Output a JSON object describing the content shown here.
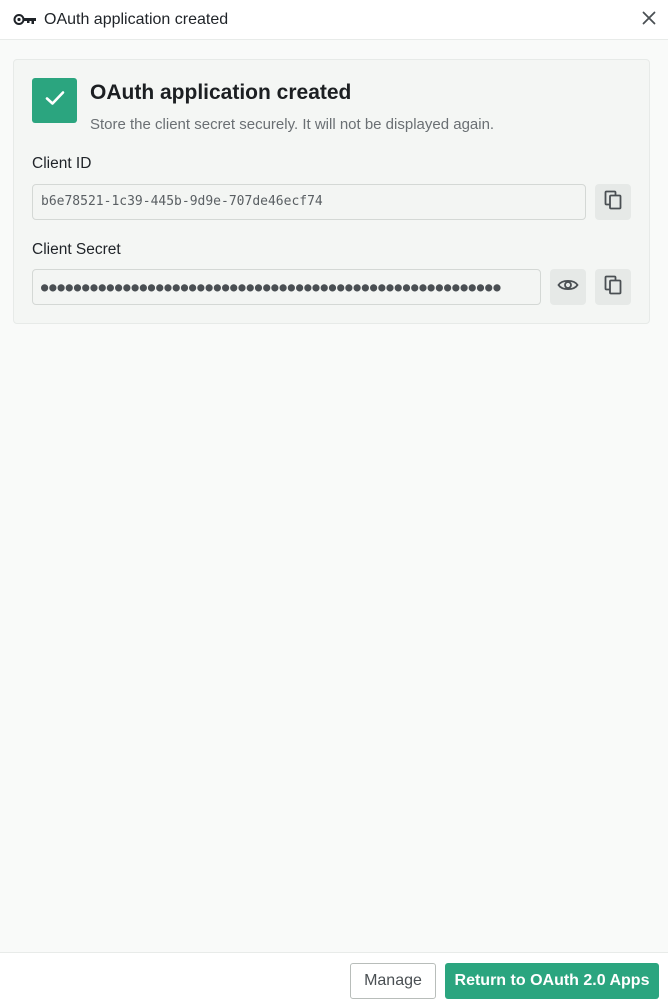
{
  "window": {
    "title": "OAuth application created",
    "title_icon": "key-icon",
    "close_icon": "close-icon"
  },
  "card": {
    "status_icon": "check-icon",
    "title": "OAuth application created",
    "subtitle": "Store the client secret securely. It will not be displayed again.",
    "client_id": {
      "label": "Client ID",
      "value": "b6e78521-1c39-445b-9d9e-707de46ecf74",
      "copy_icon": "copy-icon"
    },
    "client_secret": {
      "label": "Client Secret",
      "value": "●●●●●●●●●●●●●●●●●●●●●●●●●●●●●●●●●●●●●●●●●●●●●●●●●●●●●●●●",
      "reveal_icon": "eye-icon",
      "copy_icon": "copy-icon"
    }
  },
  "footer": {
    "manage_label": "Manage",
    "return_label": "Return to OAuth 2.0 Apps"
  },
  "colors": {
    "accent": "#2ba57f",
    "background": "#f9faf9",
    "card_background": "#f4f6f4"
  }
}
